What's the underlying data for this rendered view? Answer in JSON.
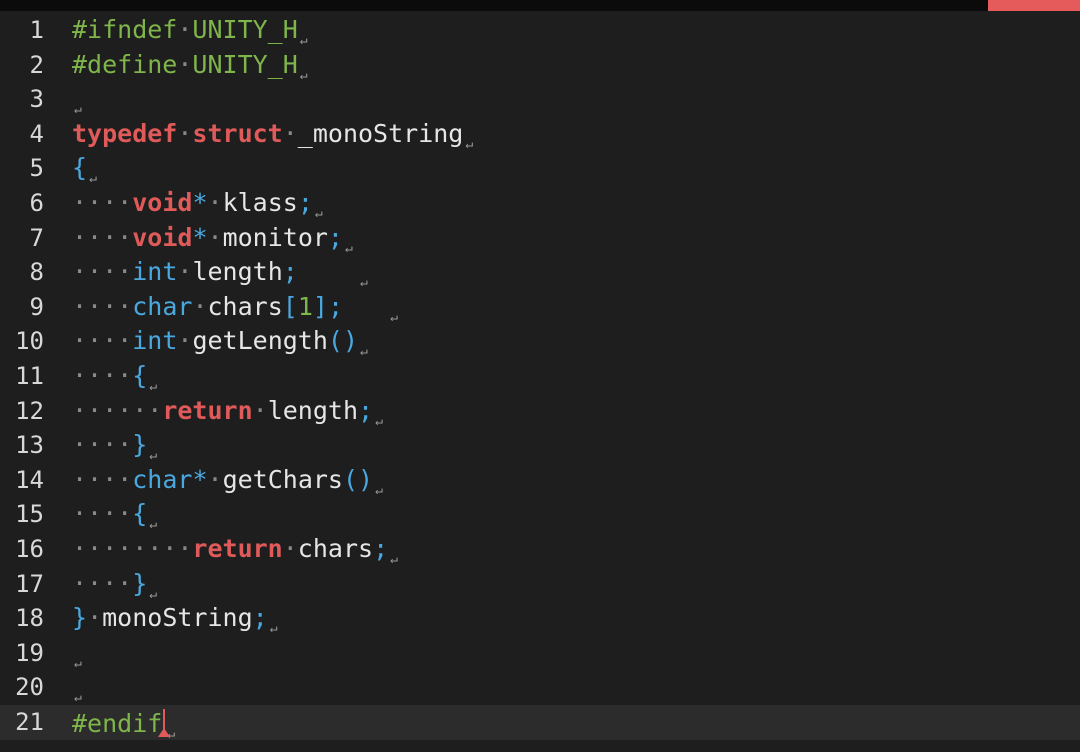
{
  "editor": {
    "current_line": 21,
    "lines": [
      {
        "n": "1",
        "tokens": [
          {
            "t": "pre",
            "v": "#ifndef"
          },
          {
            "t": "ws",
            "v": "·"
          },
          {
            "t": "pre",
            "v": "UNITY_H"
          },
          {
            "t": "eol",
            "v": "↵"
          }
        ]
      },
      {
        "n": "2",
        "tokens": [
          {
            "t": "pre",
            "v": "#define"
          },
          {
            "t": "ws",
            "v": "·"
          },
          {
            "t": "pre",
            "v": "UNITY_H"
          },
          {
            "t": "eol",
            "v": "↵"
          }
        ]
      },
      {
        "n": "3",
        "tokens": [
          {
            "t": "eol",
            "v": "↵"
          }
        ]
      },
      {
        "n": "4",
        "tokens": [
          {
            "t": "kw",
            "v": "typedef"
          },
          {
            "t": "ws",
            "v": "·"
          },
          {
            "t": "kw",
            "v": "struct"
          },
          {
            "t": "ws",
            "v": "·"
          },
          {
            "t": "id",
            "v": "_monoString"
          },
          {
            "t": "eol",
            "v": "↵"
          }
        ]
      },
      {
        "n": "5",
        "tokens": [
          {
            "t": "punc",
            "v": "{"
          },
          {
            "t": "eol",
            "v": "↵"
          }
        ]
      },
      {
        "n": "6",
        "tokens": [
          {
            "t": "ws",
            "v": "····"
          },
          {
            "t": "kw",
            "v": "void"
          },
          {
            "t": "punc",
            "v": "*"
          },
          {
            "t": "ws",
            "v": "·"
          },
          {
            "t": "id",
            "v": "klass"
          },
          {
            "t": "punc",
            "v": ";"
          },
          {
            "t": "eol",
            "v": "↵"
          }
        ]
      },
      {
        "n": "7",
        "tokens": [
          {
            "t": "ws",
            "v": "····"
          },
          {
            "t": "kw",
            "v": "void"
          },
          {
            "t": "punc",
            "v": "*"
          },
          {
            "t": "ws",
            "v": "·"
          },
          {
            "t": "id",
            "v": "monitor"
          },
          {
            "t": "punc",
            "v": ";"
          },
          {
            "t": "eol",
            "v": "↵"
          }
        ]
      },
      {
        "n": "8",
        "tokens": [
          {
            "t": "ws",
            "v": "····"
          },
          {
            "t": "type",
            "v": "int"
          },
          {
            "t": "ws",
            "v": "·"
          },
          {
            "t": "id",
            "v": "length"
          },
          {
            "t": "punc",
            "v": ";"
          },
          {
            "t": "id",
            "v": "    "
          },
          {
            "t": "eol",
            "v": "↵"
          }
        ]
      },
      {
        "n": "9",
        "tokens": [
          {
            "t": "ws",
            "v": "····"
          },
          {
            "t": "type",
            "v": "char"
          },
          {
            "t": "ws",
            "v": "·"
          },
          {
            "t": "id",
            "v": "chars"
          },
          {
            "t": "punc",
            "v": "["
          },
          {
            "t": "num",
            "v": "1"
          },
          {
            "t": "punc",
            "v": "];"
          },
          {
            "t": "id",
            "v": "   "
          },
          {
            "t": "eol",
            "v": "↵"
          }
        ]
      },
      {
        "n": "10",
        "tokens": [
          {
            "t": "ws",
            "v": "····"
          },
          {
            "t": "type",
            "v": "int"
          },
          {
            "t": "ws",
            "v": "·"
          },
          {
            "t": "id",
            "v": "getLength"
          },
          {
            "t": "punc",
            "v": "()"
          },
          {
            "t": "eol",
            "v": "↵"
          }
        ]
      },
      {
        "n": "11",
        "tokens": [
          {
            "t": "ws",
            "v": "····"
          },
          {
            "t": "punc",
            "v": "{"
          },
          {
            "t": "eol",
            "v": "↵"
          }
        ]
      },
      {
        "n": "12",
        "tokens": [
          {
            "t": "ws",
            "v": "······"
          },
          {
            "t": "kw",
            "v": "return"
          },
          {
            "t": "ws",
            "v": "·"
          },
          {
            "t": "id",
            "v": "length"
          },
          {
            "t": "punc",
            "v": ";"
          },
          {
            "t": "eol",
            "v": "↵"
          }
        ]
      },
      {
        "n": "13",
        "tokens": [
          {
            "t": "ws",
            "v": "····"
          },
          {
            "t": "punc",
            "v": "}"
          },
          {
            "t": "eol",
            "v": "↵"
          }
        ]
      },
      {
        "n": "14",
        "tokens": [
          {
            "t": "ws",
            "v": "····"
          },
          {
            "t": "type",
            "v": "char"
          },
          {
            "t": "punc",
            "v": "*"
          },
          {
            "t": "ws",
            "v": "·"
          },
          {
            "t": "id",
            "v": "getChars"
          },
          {
            "t": "punc",
            "v": "()"
          },
          {
            "t": "eol",
            "v": "↵"
          }
        ]
      },
      {
        "n": "15",
        "tokens": [
          {
            "t": "ws",
            "v": "····"
          },
          {
            "t": "punc",
            "v": "{"
          },
          {
            "t": "eol",
            "v": "↵"
          }
        ]
      },
      {
        "n": "16",
        "tokens": [
          {
            "t": "ws",
            "v": "········"
          },
          {
            "t": "kw",
            "v": "return"
          },
          {
            "t": "ws",
            "v": "·"
          },
          {
            "t": "id",
            "v": "chars"
          },
          {
            "t": "punc",
            "v": ";"
          },
          {
            "t": "eol",
            "v": "↵"
          }
        ]
      },
      {
        "n": "17",
        "tokens": [
          {
            "t": "ws",
            "v": "····"
          },
          {
            "t": "punc",
            "v": "}"
          },
          {
            "t": "eol",
            "v": "↵"
          }
        ]
      },
      {
        "n": "18",
        "tokens": [
          {
            "t": "punc",
            "v": "}"
          },
          {
            "t": "ws",
            "v": "·"
          },
          {
            "t": "id",
            "v": "monoString"
          },
          {
            "t": "punc",
            "v": ";"
          },
          {
            "t": "eol",
            "v": "↵"
          }
        ]
      },
      {
        "n": "19",
        "tokens": [
          {
            "t": "eol",
            "v": "↵"
          }
        ]
      },
      {
        "n": "20",
        "tokens": [
          {
            "t": "eol",
            "v": "↵"
          }
        ]
      },
      {
        "n": "21",
        "tokens": [
          {
            "t": "pre",
            "v": "#endif"
          },
          {
            "t": "cursor",
            "v": ""
          },
          {
            "t": "eol",
            "v": "↵"
          }
        ]
      }
    ]
  },
  "colors": {
    "background": "#1e1e1e",
    "preprocessor": "#7fb54a",
    "keyword": "#e05a5a",
    "type": "#4aa8e0",
    "accent": "#e55a5a"
  }
}
